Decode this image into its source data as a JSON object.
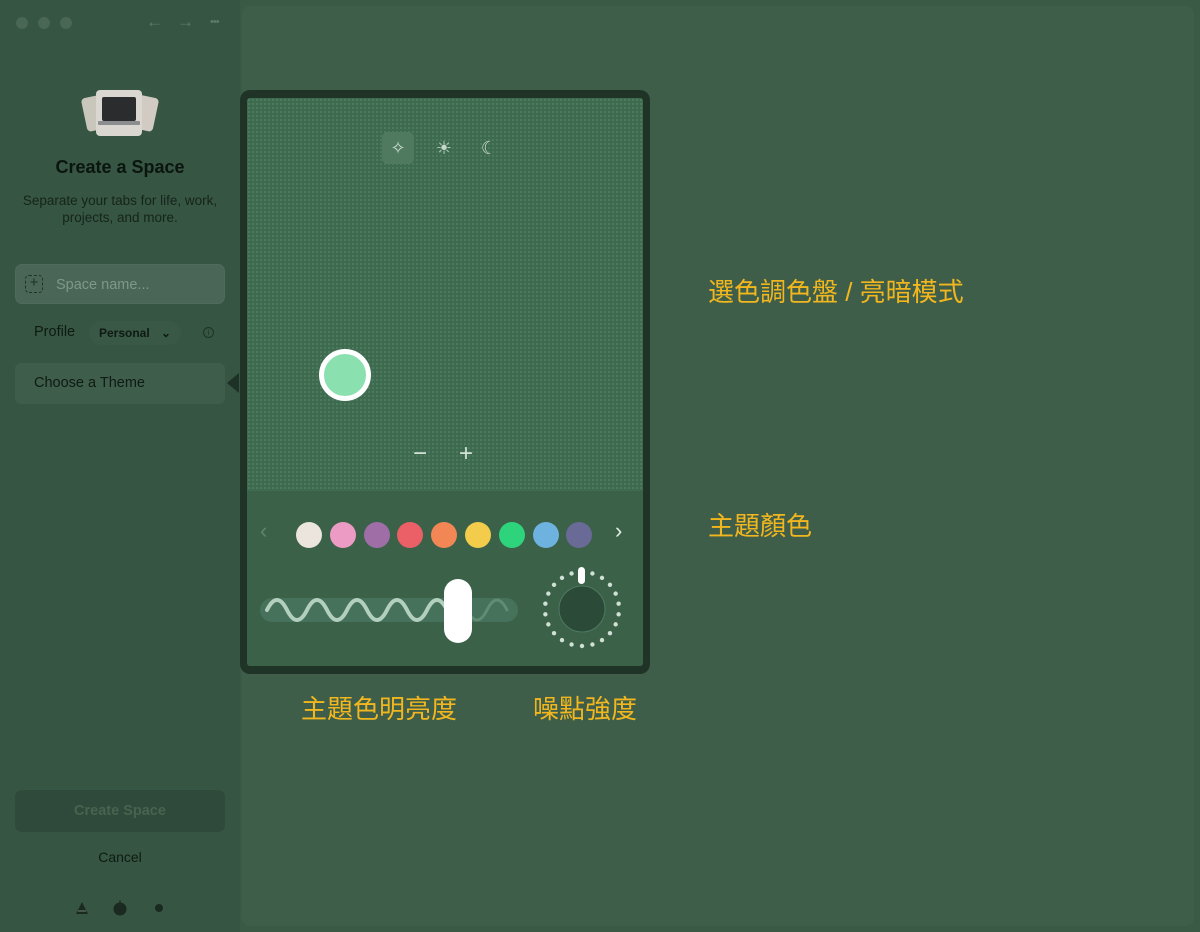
{
  "window": {
    "back_icon": "←",
    "forward_icon": "→",
    "more_icon": "•••"
  },
  "sidebar": {
    "title": "Create a Space",
    "subtitle": "Separate your tabs for life, work, projects, and more.",
    "space_name_placeholder": "Space name...",
    "profile_label": "Profile",
    "profile_value": "Personal",
    "profile_chevron": "⌄",
    "info_icon": "i",
    "theme_label": "Choose a Theme",
    "create_button": "Create Space",
    "cancel_button": "Cancel"
  },
  "picker": {
    "modes": [
      {
        "name": "auto",
        "icon": "✧"
      },
      {
        "name": "light",
        "icon": "☀"
      },
      {
        "name": "dark",
        "icon": "☾"
      }
    ],
    "active_mode": "auto",
    "selected_color": "#8be0b0",
    "zoom_out": "−",
    "zoom_in": "+",
    "prev": "‹",
    "next": "›",
    "swatches": [
      "#ebe5de",
      "#ec9cc4",
      "#a06ea6",
      "#eb5f67",
      "#f28655",
      "#f2cc4a",
      "#2ed47c",
      "#6eb2e0",
      "#6a6a96"
    ],
    "brightness": 0.8
  },
  "annotations": {
    "palette_mode": "選色調色盤 / 亮暗模式",
    "theme_color": "主題顏色",
    "brightness": "主題色明亮度",
    "noise": "噪點強度"
  }
}
